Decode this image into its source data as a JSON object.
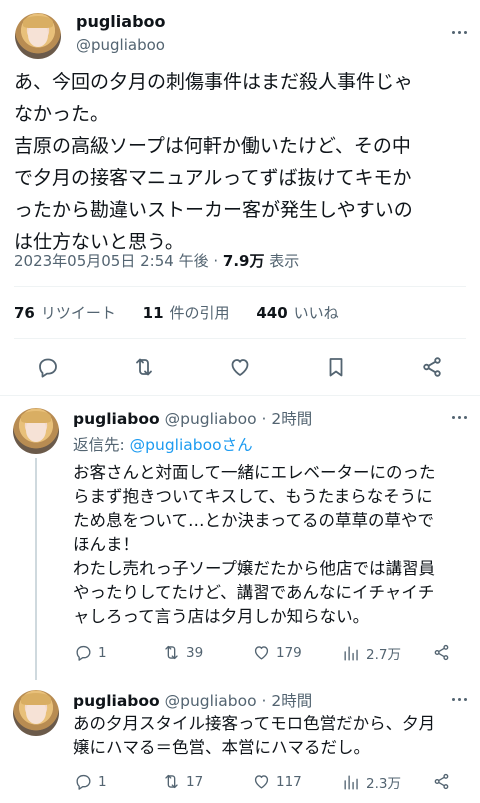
{
  "main_tweet": {
    "name": "pugliaboo",
    "handle": "@pugliaboo",
    "text": "あ、今回の夕月の刺傷事件はまだ殺人事件じゃ\nなかった。\n吉原の高級ソープは何軒か働いたけど、その中\nで夕月の接客マニュアルってずば抜けてキモか\nったから勘違いストーカー客が発生しやすいの\nは仕方ないと思う。",
    "timestamp": "2023年05月05日 2:54 午後",
    "separator": " · ",
    "views_value": "7.9万",
    "views_label": " 表示",
    "retweets_count": "76",
    "retweets_label": "リツイート",
    "quotes_count": "11",
    "quotes_label": "件の引用",
    "likes_count": "440",
    "likes_label": "いいね"
  },
  "icons": {
    "avatar": "avatar-icon",
    "more": "more-dots-icon",
    "reply": "reply-icon",
    "retweet": "retweet-icon",
    "like": "heart-icon",
    "bookmark": "bookmark-icon",
    "share": "share-icon",
    "views": "views-bar-icon"
  },
  "colors": {
    "link": "#1d9bf0",
    "secondary_text": "#536471",
    "divider": "#eff3f4"
  },
  "replies": [
    {
      "name": "pugliaboo",
      "meta": "@pugliaboo · 2時間",
      "reply_to_label": "返信先: ",
      "reply_to_link": "@pugliabooさん",
      "text": "お客さんと対面して一緒にエレベーターにのった\nらまず抱きついてキスして、もうたまらなそうに\nため息をついて…とか決まってるの草草の草やで\nほんま！\nわたし売れっ子ソープ嬢だたから他店では講習員\nやったりしてたけど、講習であんなにイチャイチ\nャしろって言う店は夕月しか知らない。",
      "replies": "1",
      "retweets": "39",
      "likes": "179",
      "views": "2.7万"
    },
    {
      "name": "pugliaboo",
      "meta": "@pugliaboo · 2時間",
      "text": "あの夕月スタイル接客ってモロ色営だから、夕月\n嬢にハマる＝色営、本営にハマるだし。",
      "replies": "1",
      "retweets": "17",
      "likes": "117",
      "views": "2.3万"
    }
  ]
}
